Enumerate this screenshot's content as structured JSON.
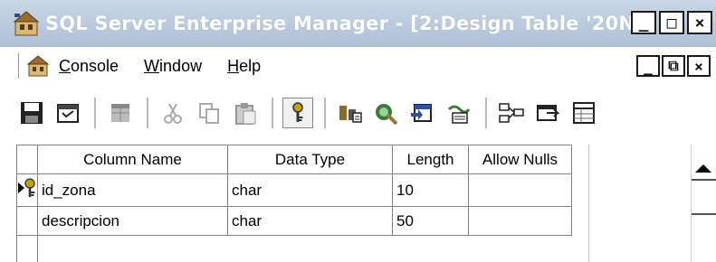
{
  "window": {
    "title": "SQL Server Enterprise Manager - [2:Design Table '20N...",
    "controls": {
      "minimize": "_",
      "maximize": "□",
      "close": "×"
    }
  },
  "menubar": {
    "items": [
      {
        "label_ul": "C",
        "label_rest": "onsole"
      },
      {
        "label_ul": "W",
        "label_rest": "indow"
      },
      {
        "label_ul": "H",
        "label_rest": "elp"
      }
    ],
    "mdi_controls": {
      "minimize": "_",
      "restore": "⧉",
      "close": "×"
    }
  },
  "toolbar": {
    "buttons": [
      "save-icon",
      "properties-icon",
      "insert-column-icon",
      "cut-icon",
      "copy-icon",
      "paste-icon",
      "primary-key-icon",
      "manage-indexes-icon",
      "manage-constraints-icon",
      "manage-triggers-icon",
      "manage-relationships-icon",
      "generate-script-icon",
      "manage-checks-icon",
      "view-icon"
    ]
  },
  "grid": {
    "columns": [
      "Column Name",
      "Data Type",
      "Length",
      "Allow Nulls"
    ],
    "rows": [
      {
        "name": "id_zona",
        "type": "char",
        "length": "10",
        "allow_nulls": "",
        "is_primary_key": true,
        "is_current": true
      },
      {
        "name": "descripcion",
        "type": "char",
        "length": "50",
        "allow_nulls": "",
        "is_primary_key": false,
        "is_current": false
      }
    ]
  },
  "colors": {
    "titlebar": "#aebfd7",
    "grid_border": "#808080",
    "key_icon": "#c8a000"
  }
}
